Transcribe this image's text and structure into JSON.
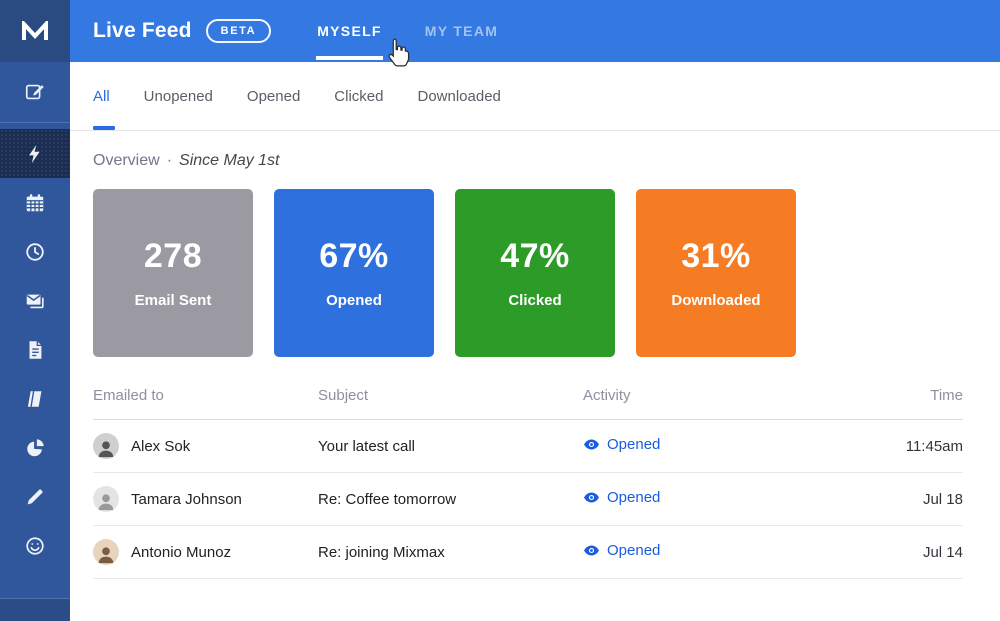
{
  "colors": {
    "header_bg": "#3379E1",
    "sidebar_bg": "#30569B",
    "logo_bg": "#2A4A82",
    "active_item_bg": "#1B2D52",
    "accent_blue": "#2B6DE0",
    "link_blue": "#1A5CE0"
  },
  "header": {
    "title": "Live Feed",
    "badge": "BETA",
    "tabs": [
      {
        "label": "MYSELF",
        "active": true
      },
      {
        "label": "MY TEAM",
        "active": false
      }
    ],
    "cursor_icon": "hand-pointer-icon"
  },
  "sidebar": {
    "logo_icon": "mixmax-logo",
    "items": [
      {
        "icon": "compose-icon",
        "active": false
      },
      {
        "icon": "lightning-icon",
        "active": true
      },
      {
        "icon": "calendar-icon",
        "active": false
      },
      {
        "icon": "clock-icon",
        "active": false
      },
      {
        "icon": "mail-stack-icon",
        "active": false
      },
      {
        "icon": "document-icon",
        "active": false
      },
      {
        "icon": "book-icon",
        "active": false
      },
      {
        "icon": "pie-chart-icon",
        "active": false
      },
      {
        "icon": "pencil-icon",
        "active": false
      },
      {
        "icon": "smiley-icon",
        "active": false
      }
    ]
  },
  "filters": {
    "tabs": [
      {
        "label": "All",
        "active": true
      },
      {
        "label": "Unopened",
        "active": false
      },
      {
        "label": "Opened",
        "active": false
      },
      {
        "label": "Clicked",
        "active": false
      },
      {
        "label": "Downloaded",
        "active": false
      }
    ]
  },
  "overview": {
    "title": "Overview",
    "separator": "·",
    "subtitle": "Since May 1st",
    "cards": [
      {
        "value": "278",
        "label": "Email Sent",
        "color": "#9B9AA3"
      },
      {
        "value": "67%",
        "label": "Opened",
        "color": "#2E70DE"
      },
      {
        "value": "47%",
        "label": "Clicked",
        "color": "#2D9B28"
      },
      {
        "value": "31%",
        "label": "Downloaded",
        "color": "#F57C22"
      }
    ]
  },
  "table": {
    "columns": [
      "Emailed to",
      "Subject",
      "Activity",
      "Time"
    ],
    "rows": [
      {
        "name": "Alex Sok",
        "subject": "Your latest call",
        "activity": "Opened",
        "activity_icon": "eye-icon",
        "time": "11:45am"
      },
      {
        "name": "Tamara Johnson",
        "subject": "Re: Coffee tomorrow",
        "activity": "Opened",
        "activity_icon": "eye-icon",
        "time": "Jul 18"
      },
      {
        "name": "Antonio Munoz",
        "subject": "Re: joining Mixmax",
        "activity": "Opened",
        "activity_icon": "eye-icon",
        "time": "Jul 14"
      }
    ]
  }
}
